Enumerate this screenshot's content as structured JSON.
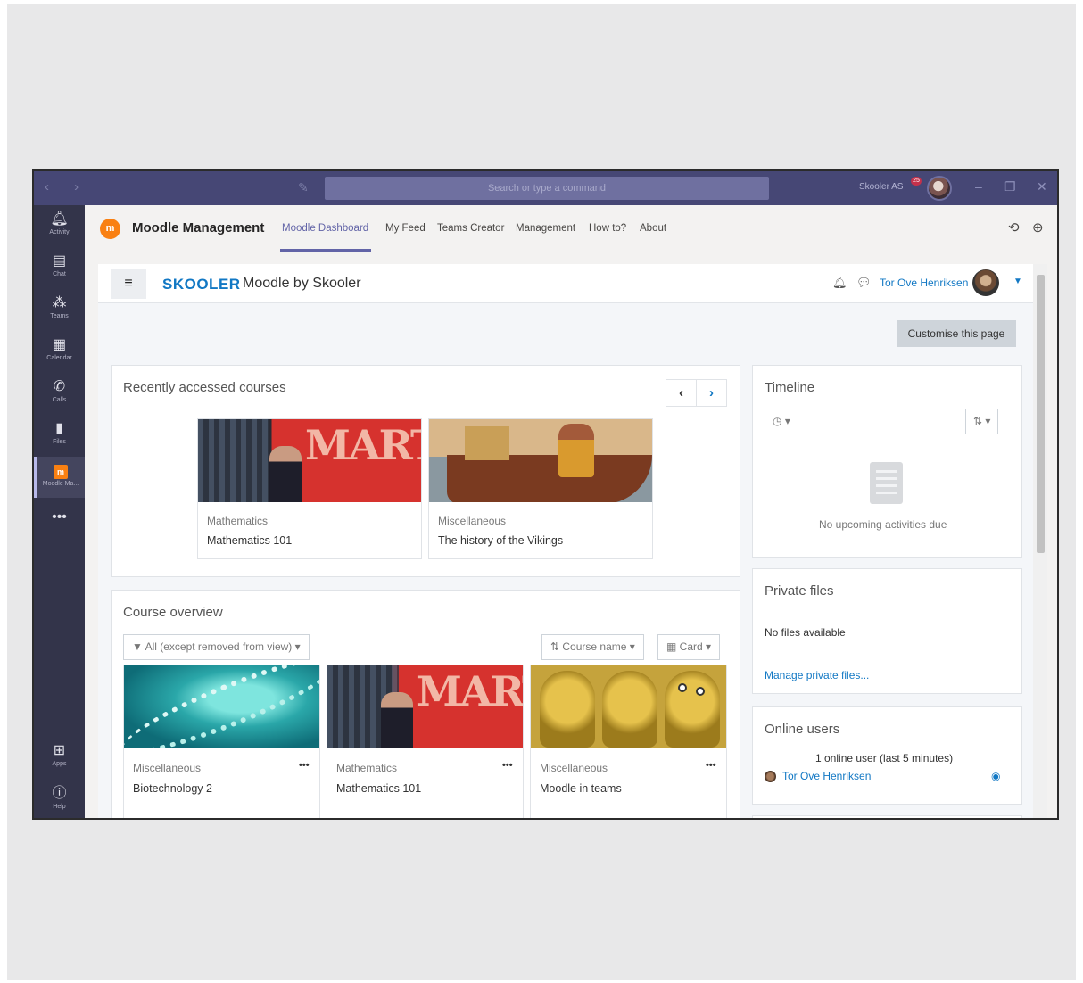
{
  "titlebar": {
    "search_placeholder": "Search or type a command",
    "tenant": "Skooler AS",
    "tenant_badge": "25",
    "nav_arrows": "‹ ›",
    "window_buttons": [
      "–",
      "❐",
      "✕"
    ]
  },
  "rail": {
    "items": [
      {
        "label": "Activity",
        "icon": "bell-icon"
      },
      {
        "label": "Chat",
        "icon": "chat-icon"
      },
      {
        "label": "Teams",
        "icon": "teams-icon"
      },
      {
        "label": "Calendar",
        "icon": "calendar-icon"
      },
      {
        "label": "Calls",
        "icon": "phone-icon"
      },
      {
        "label": "Files",
        "icon": "file-icon"
      },
      {
        "label": "Moodle Ma...",
        "icon": "moodle-icon"
      }
    ],
    "more": "•••",
    "apps_label": "Apps",
    "help_label": "Help"
  },
  "app_header": {
    "logo_text": "m",
    "name": "Moodle Management",
    "tabs": [
      "Moodle Dashboard",
      "My Feed",
      "Teams Creator",
      "Management",
      "How to?",
      "About"
    ],
    "active_tab": "Moodle Dashboard"
  },
  "navbar": {
    "brand": "SKOOLER",
    "brand_sub": "Moodle by Skooler",
    "user_name": "Tor Ove Henriksen"
  },
  "customise_button": "Customise this page",
  "recent_courses": {
    "title": "Recently accessed courses",
    "courses": [
      {
        "category": "Mathematics",
        "name": "Mathematics 101"
      },
      {
        "category": "Miscellaneous",
        "name": "The history of the Vikings"
      }
    ]
  },
  "timeline": {
    "title": "Timeline",
    "empty_text": "No upcoming activities due"
  },
  "private_files": {
    "title": "Private files",
    "empty_text": "No files available",
    "manage_link": "Manage private files..."
  },
  "online_users": {
    "title": "Online users",
    "summary": "1 online user (last 5 minutes)",
    "user": "Tor Ove Henriksen"
  },
  "course_overview": {
    "title": "Course overview",
    "filter": "All (except removed from view)",
    "sort": "Course name",
    "view": "Card",
    "courses": [
      {
        "category": "Miscellaneous",
        "name": "Biotechnology 2"
      },
      {
        "category": "Mathematics",
        "name": "Mathematics 101"
      },
      {
        "category": "Miscellaneous",
        "name": "Moodle in teams"
      }
    ]
  },
  "colors": {
    "teams_purple": "#464775",
    "rail": "#33344a",
    "moodle_orange": "#f98012",
    "link_blue": "#1278c4"
  },
  "image_text": {
    "martin": "MARTIN"
  }
}
